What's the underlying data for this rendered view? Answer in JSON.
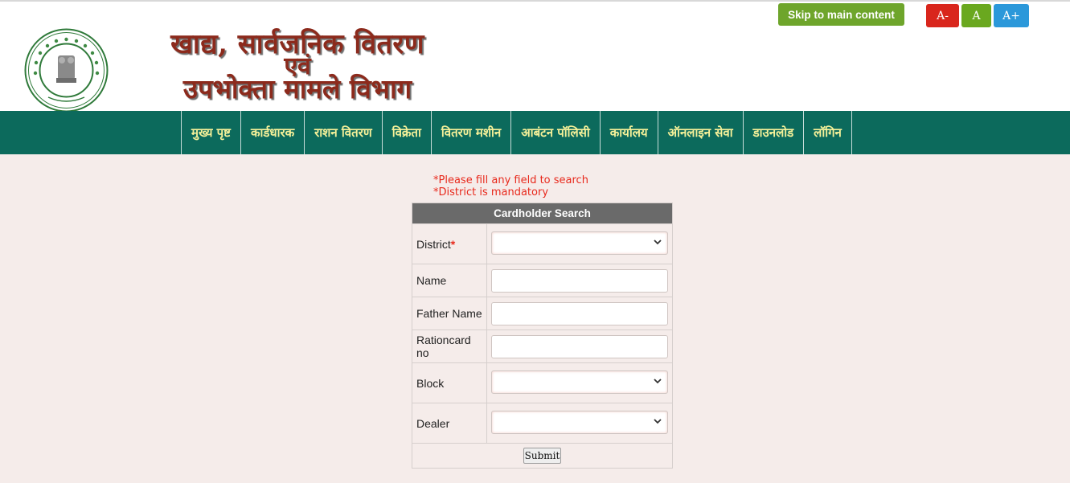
{
  "header": {
    "title_line1": "खाद्य, सार्वजनिक वितरण",
    "title_line2": "एवं",
    "title_line3": "उपभोक्ता मामले विभाग",
    "emblem": {
      "icon": "jharkhand-government-seal-icon",
      "text_top": "GOVERNMENT OF JHARKHAND",
      "text_bottom": "झारखण्ड सरकार"
    }
  },
  "top_bar": {
    "skip_label": "Skip to main content",
    "font_decrease": "A-",
    "font_normal": "A",
    "font_increase": "A+"
  },
  "nav": {
    "items": [
      {
        "label": "मुख्य पृष्ट"
      },
      {
        "label": "कार्डधारक"
      },
      {
        "label": "राशन वितरण"
      },
      {
        "label": "विक्रेता"
      },
      {
        "label": "वितरण मशीन"
      },
      {
        "label": "आबंटन पॉलिसी"
      },
      {
        "label": "कार्यालय"
      },
      {
        "label": "ऑनलाइन सेवा"
      },
      {
        "label": "डाउनलोड"
      },
      {
        "label": "लॉगिन"
      }
    ]
  },
  "messages": {
    "fill_any": "*Please fill any field to search",
    "district_mandatory": "*District is mandatory"
  },
  "form": {
    "title": "Cardholder Search",
    "district_label": "District",
    "required_mark": "*",
    "name_label": "Name",
    "father_label": "Father Name",
    "rationcard_label": "Rationcard no",
    "block_label": "Block",
    "dealer_label": "Dealer",
    "submit_label": "Submit"
  },
  "colors": {
    "nav_bg": "#0c6a5c",
    "nav_text": "#f6f199",
    "page_bg": "#f5ecea",
    "error_text": "#e8291c",
    "table_header": "#6a6a6a"
  }
}
